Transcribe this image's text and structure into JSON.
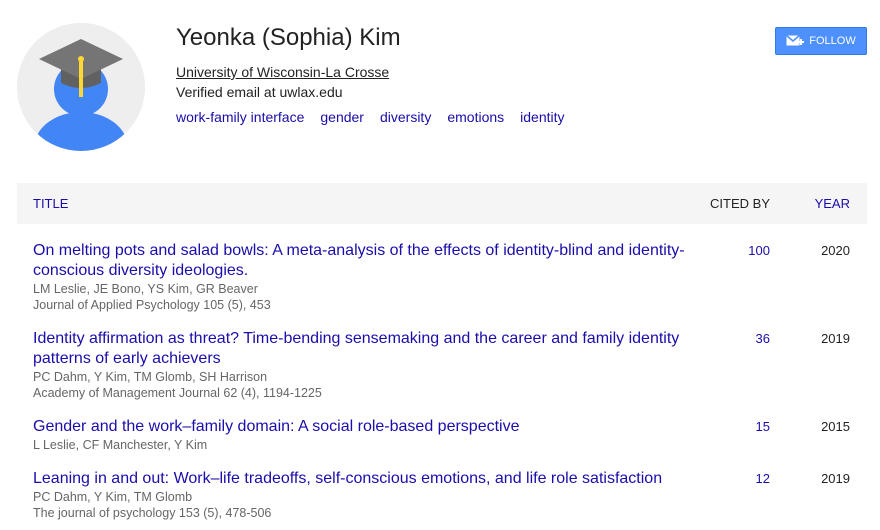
{
  "profile": {
    "name": "Yeonka (Sophia) Kim",
    "affiliation": "University of Wisconsin-La Crosse",
    "email": "Verified email at uwlax.edu",
    "interests": [
      "work-family interface",
      "gender",
      "diversity",
      "emotions",
      "identity"
    ]
  },
  "follow_label": "FOLLOW",
  "table": {
    "title_header": "TITLE",
    "cited_header": "CITED BY",
    "year_header": "YEAR"
  },
  "publications": [
    {
      "title": "On melting pots and salad bowls: A meta-analysis of the effects of identity-blind and identity-conscious diversity ideologies.",
      "authors": "LM Leslie, JE Bono, YS Kim, GR Beaver",
      "venue": "Journal of Applied Psychology 105 (5), 453",
      "cited_by": "100",
      "year": "2020"
    },
    {
      "title": "Identity affirmation as threat? Time-bending sensemaking and the career and family identity patterns of early achievers",
      "authors": "PC Dahm, Y Kim, TM Glomb, SH Harrison",
      "venue": "Academy of Management Journal 62 (4), 1194-1225",
      "cited_by": "36",
      "year": "2019"
    },
    {
      "title": "Gender and the work–family domain: A social role-based perspective",
      "authors": "L Leslie, CF Manchester, Y Kim",
      "venue": "",
      "cited_by": "15",
      "year": "2015"
    },
    {
      "title": "Leaning in and out: Work–life tradeoffs, self-conscious emotions, and life role satisfaction",
      "authors": "PC Dahm, Y Kim, TM Glomb",
      "venue": "The journal of psychology 153 (5), 478-506",
      "cited_by": "12",
      "year": "2019"
    }
  ],
  "colors": {
    "link": "#1a0dab",
    "follow_button": "#4d90fe",
    "header_bg": "#f5f5f5",
    "avatar_body": "#4285f4",
    "cap": "#757575",
    "tassel": "#fdd835"
  },
  "icons": {
    "avatar": "graduate-avatar-icon",
    "follow": "mail-plus-icon"
  }
}
